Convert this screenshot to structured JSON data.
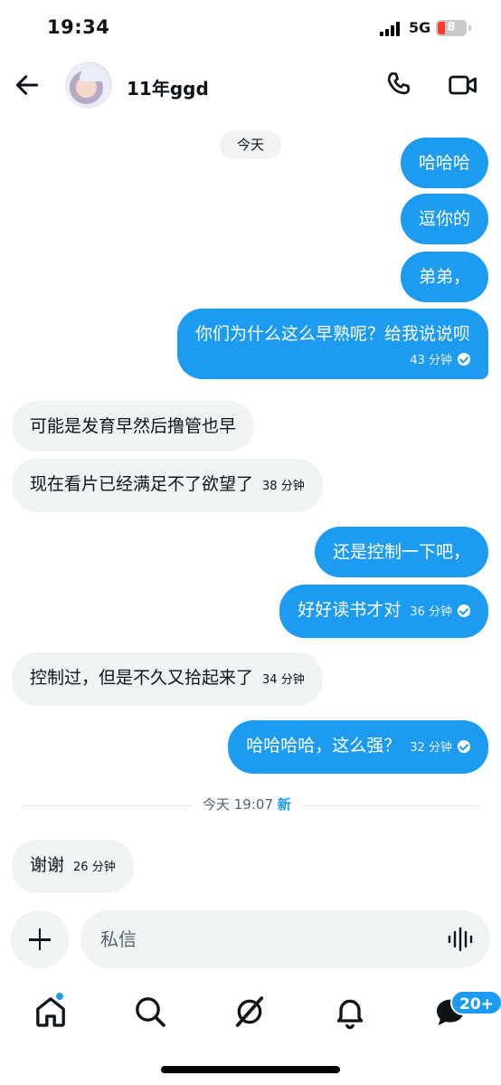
{
  "status": {
    "time": "19:34",
    "network": "5G",
    "battery": "8"
  },
  "header": {
    "name": "11年ggd",
    "back_icon": "arrow-left-icon",
    "call_icon": "phone-icon",
    "video_icon": "video-camera-icon"
  },
  "chat": {
    "date_pill": "今天",
    "messages": [
      {
        "dir": "out",
        "text": "哈哈哈"
      },
      {
        "dir": "out",
        "text": "逗你的"
      },
      {
        "dir": "out",
        "text": "弟弟，"
      },
      {
        "dir": "out",
        "text": "你们为什么这么早熟呢？给我说说呗",
        "time": "43 分钟"
      },
      {
        "dir": "in",
        "text": "可能是发育早然后撸管也早"
      },
      {
        "dir": "in",
        "text": "现在看片已经满足不了欲望了",
        "time": "38 分钟"
      },
      {
        "dir": "out",
        "text": "还是控制一下吧，"
      },
      {
        "dir": "out",
        "text": "好好读书才对",
        "time": "36 分钟"
      },
      {
        "dir": "in",
        "text": "控制过，但是不久又拾起来了",
        "time": "34 分钟"
      },
      {
        "dir": "out",
        "text": "哈哈哈哈，这么强？",
        "time": "32 分钟"
      },
      {
        "dir": "in",
        "text": "谢谢",
        "time": "26 分钟"
      }
    ],
    "divider": {
      "label": "今天 19:07",
      "new_label": "新"
    }
  },
  "composer": {
    "placeholder": "私信"
  },
  "nav": {
    "messages_badge": "20+"
  },
  "colors": {
    "accent": "#1d9bf0",
    "incoming_bubble": "#eff3f4"
  }
}
